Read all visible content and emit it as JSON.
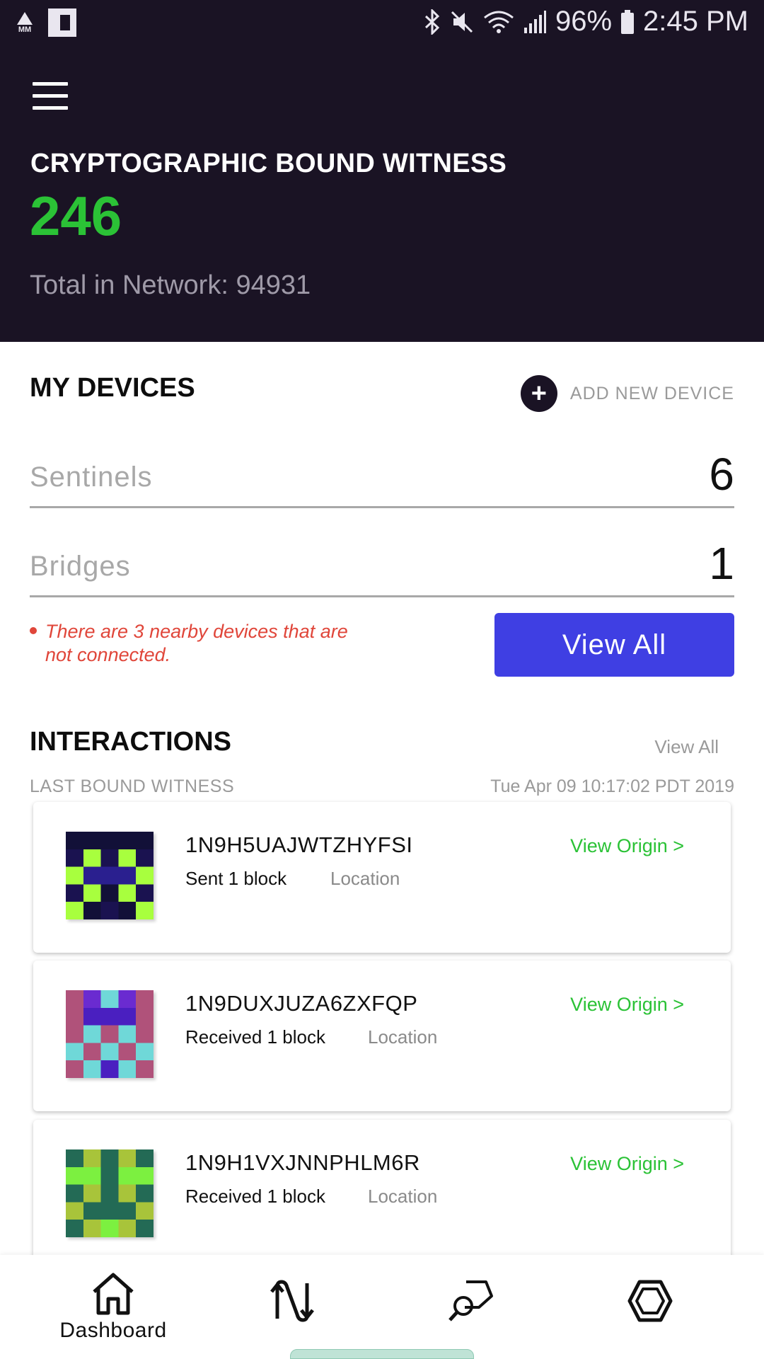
{
  "status_bar": {
    "left_icons": [
      "mm-alert-icon",
      "flipboard-icon"
    ],
    "mm_text": "MM",
    "right_icons": [
      "bluetooth-icon",
      "mute-icon",
      "wifi-icon",
      "signal-icon",
      "battery-icon"
    ],
    "battery": "96%",
    "time": "2:45 PM"
  },
  "header": {
    "title": "CRYPTOGRAPHIC BOUND WITNESS",
    "count": "246",
    "total": "Total in Network: 94931",
    "colors": {
      "background": "#1a1324",
      "count": "#2bc236"
    }
  },
  "my_devices": {
    "title": "MY DEVICES",
    "add_button_label": "ADD NEW DEVICE",
    "rows": [
      {
        "label": "Sentinels",
        "value": "6"
      },
      {
        "label": "Bridges",
        "value": "1"
      }
    ],
    "warning": "There are 3 nearby devices that are not connected.",
    "view_all_label": "View All",
    "colors": {
      "warning": "#e0463a",
      "button": "#3f3fe3"
    }
  },
  "interactions": {
    "title": "INTERACTIONS",
    "view_all_label": "View All",
    "last_label": "LAST BOUND WITNESS",
    "last_time": "Tue Apr 09 10:17:02 PDT 2019",
    "items": [
      {
        "id": "1N9H5UAJWTZHYFSI",
        "action": "Sent 1 block",
        "location": "Location",
        "origin": "View Origin >",
        "avatar": "identicon-navy-lime"
      },
      {
        "id": "1N9DUXJUZA6ZXFQP",
        "action": "Received 1 block",
        "location": "Location",
        "origin": "View Origin >",
        "avatar": "identicon-cyan-purple"
      },
      {
        "id": "1N9H1VXJNNPHLM6R",
        "action": "Received 1 block",
        "location": "Location",
        "origin": "View Origin >",
        "avatar": "identicon-green-olive"
      }
    ]
  },
  "bottom_nav": {
    "items": [
      {
        "icon": "home-icon",
        "label": "Dashboard"
      },
      {
        "icon": "exchange-icon",
        "label": ""
      },
      {
        "icon": "search-shape-icon",
        "label": ""
      },
      {
        "icon": "hexagon-icon",
        "label": ""
      }
    ]
  }
}
